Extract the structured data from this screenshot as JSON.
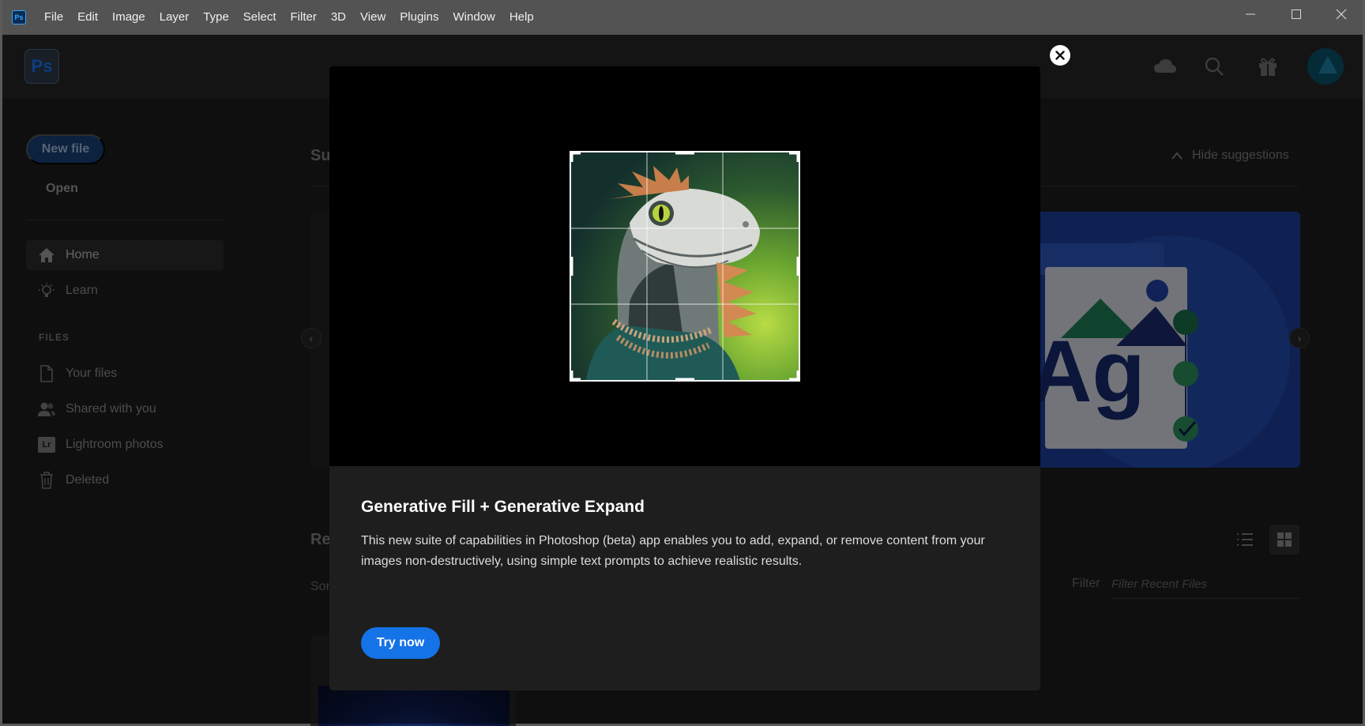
{
  "menubar": {
    "app_icon": "Ps",
    "items": [
      "File",
      "Edit",
      "Image",
      "Layer",
      "Type",
      "Select",
      "Filter",
      "3D",
      "View",
      "Plugins",
      "Window",
      "Help"
    ]
  },
  "header": {
    "logo": "Ps",
    "icons": [
      "cloud-icon",
      "search-icon",
      "gift-icon"
    ]
  },
  "sidebar": {
    "new_file_label": "New file",
    "open_label": "Open",
    "nav": [
      {
        "label": "Home",
        "icon": "home-icon",
        "active": true
      },
      {
        "label": "Learn",
        "icon": "lightbulb-icon",
        "active": false
      }
    ],
    "files_header": "FILES",
    "files": [
      {
        "label": "Your files",
        "icon": "file-icon"
      },
      {
        "label": "Shared with you",
        "icon": "people-icon"
      },
      {
        "label": "Lightroom photos",
        "icon": "lightroom-icon",
        "badge": "Lr"
      },
      {
        "label": "Deleted",
        "icon": "trash-icon"
      }
    ]
  },
  "main": {
    "suggestions_title_partial": "Su",
    "hide_suggestions_label": "Hide suggestions",
    "recent_title_partial": "Re",
    "sort_partial": "Sor",
    "filter_label": "Filter",
    "filter_placeholder": "Filter Recent Files"
  },
  "modal": {
    "title": "Generative Fill + Generative Expand",
    "description": "This new suite of capabilities in Photoshop (beta) app enables you to add, expand, or remove content from your images non-destructively, using simple text prompts to achieve realistic results.",
    "cta_label": "Try now"
  },
  "colors": {
    "accent": "#1473e6",
    "menubar": "#535353",
    "background": "#1d1d1d",
    "modal": "#1e1e1e"
  }
}
